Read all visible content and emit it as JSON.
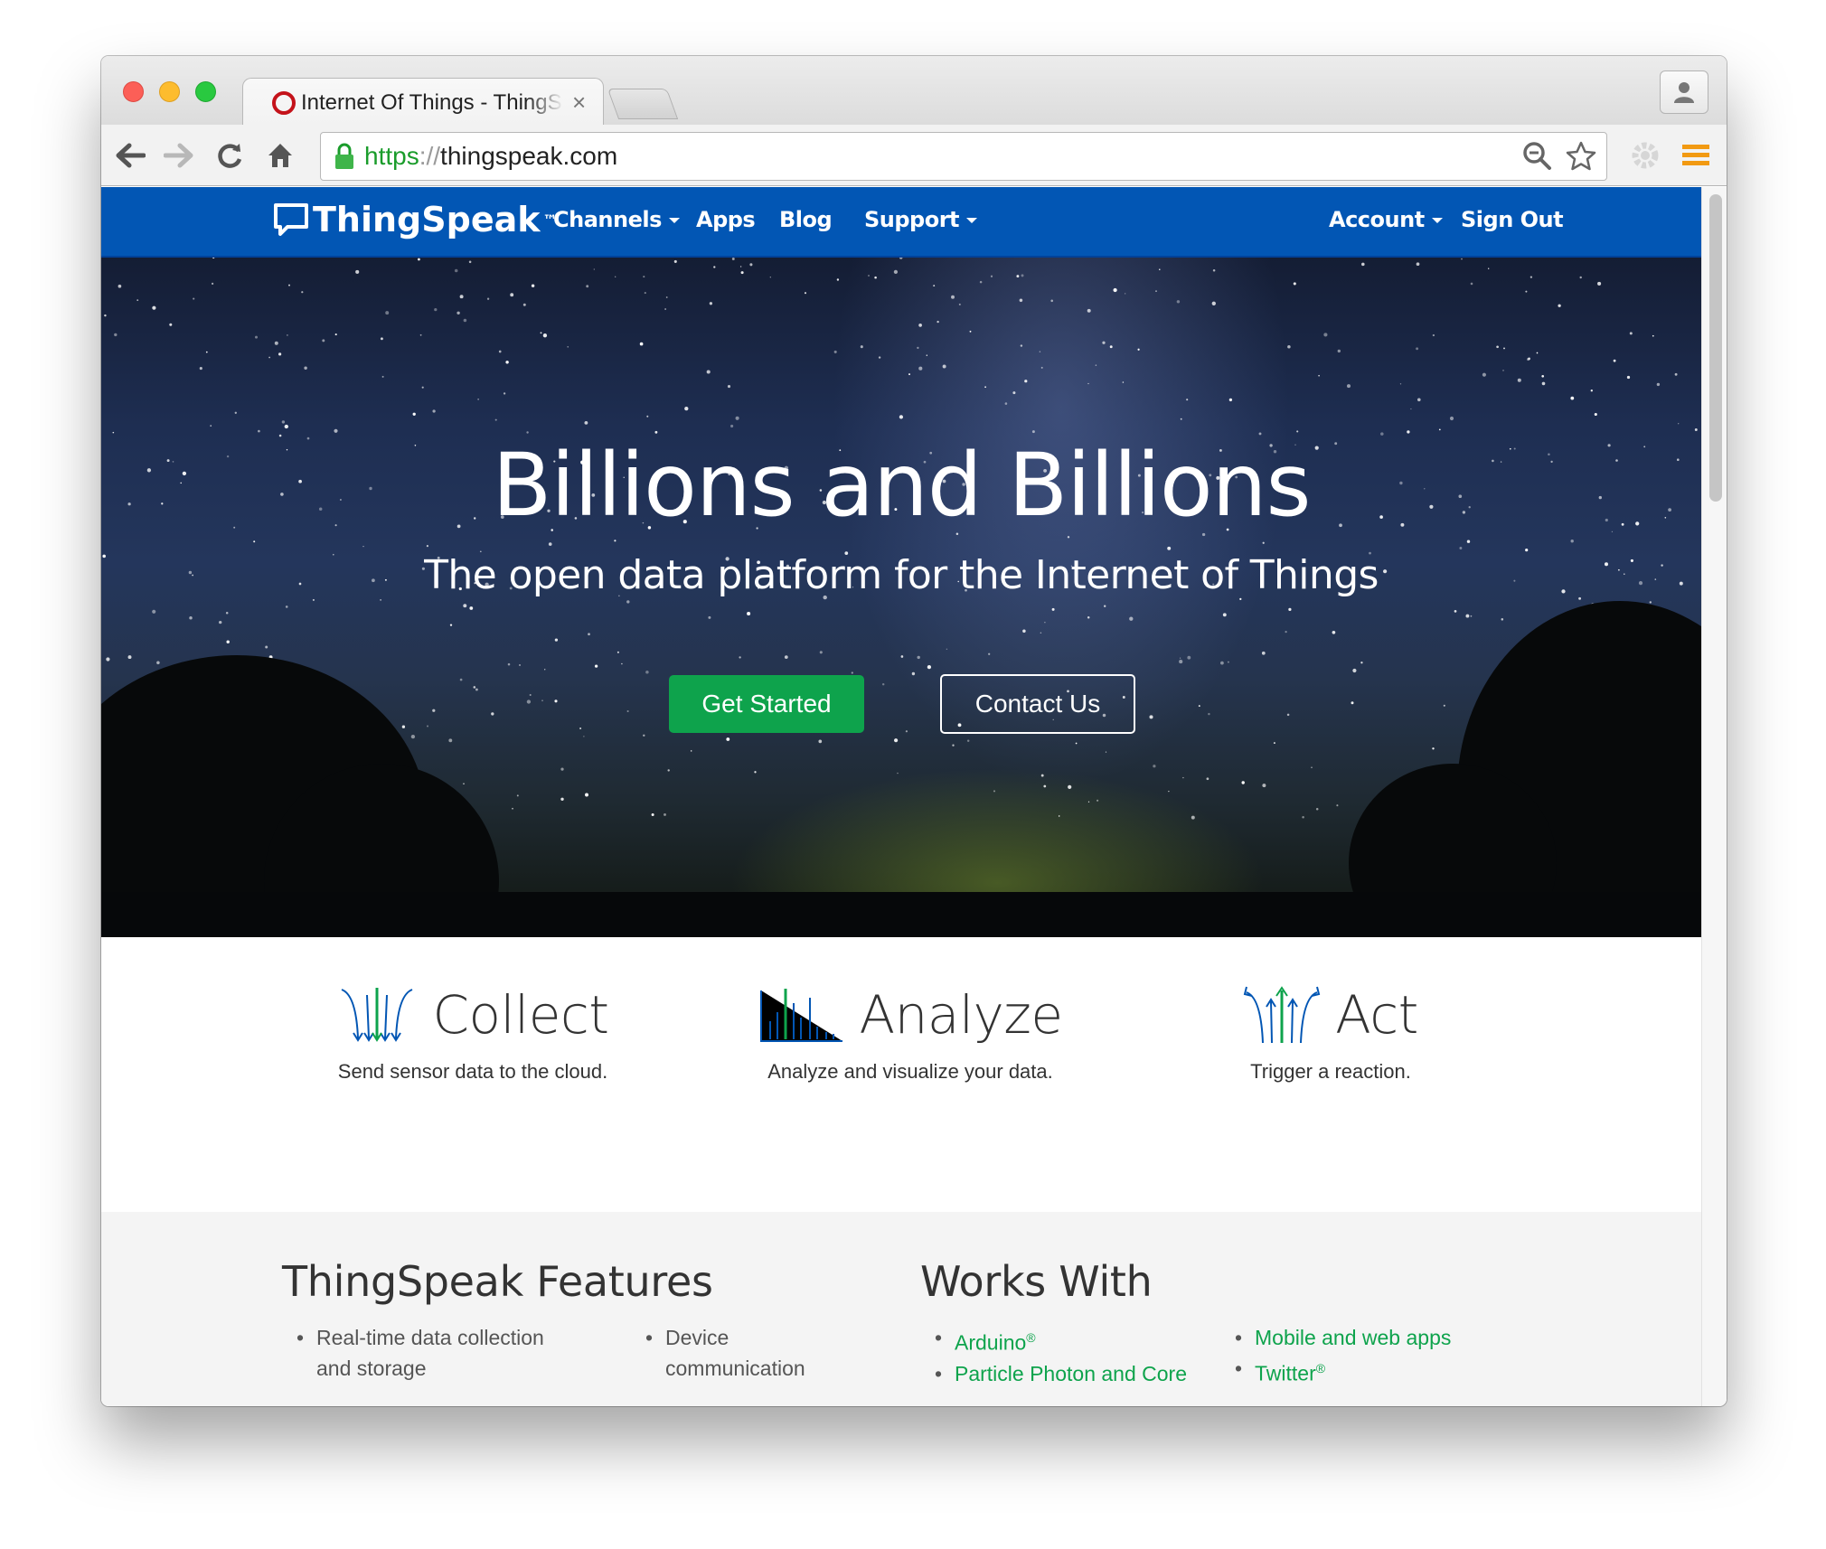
{
  "browser": {
    "tab_title": "Internet Of Things - ThingSpeak",
    "tab_close": "×",
    "url_scheme": "https",
    "url_sep": "://",
    "url_host": "thingspeak.com"
  },
  "navbar": {
    "brand": "ThingSpeak",
    "brand_tm": "™",
    "items": [
      "Channels",
      "Apps",
      "Blog",
      "Support"
    ],
    "account": "Account",
    "sign_out": "Sign Out"
  },
  "hero": {
    "title": "Billions and Billions",
    "subtitle": "The open data platform for the Internet of Things",
    "get_started": "Get Started",
    "contact_us": "Contact Us"
  },
  "features": [
    {
      "title": "Collect",
      "desc": "Send sensor data to the cloud.",
      "icon": "collect-icon"
    },
    {
      "title": "Analyze",
      "desc": "Analyze and visualize your data.",
      "icon": "analyze-icon"
    },
    {
      "title": "Act",
      "desc": "Trigger a reaction.",
      "icon": "act-icon"
    }
  ],
  "thingspeak_features": {
    "title": "ThingSpeak Features",
    "col1": [
      "Real-time data collection and storage"
    ],
    "col2": [
      "Device communication"
    ]
  },
  "works_with": {
    "title": "Works With",
    "col1": [
      "Arduino",
      "Particle Photon and Core"
    ],
    "col2": [
      "Mobile and web apps",
      "Twitter"
    ],
    "reg": "®"
  },
  "colors": {
    "navbar": "#0256b4",
    "primary_green": "#0ea34c",
    "link_green": "#0ea34c"
  }
}
